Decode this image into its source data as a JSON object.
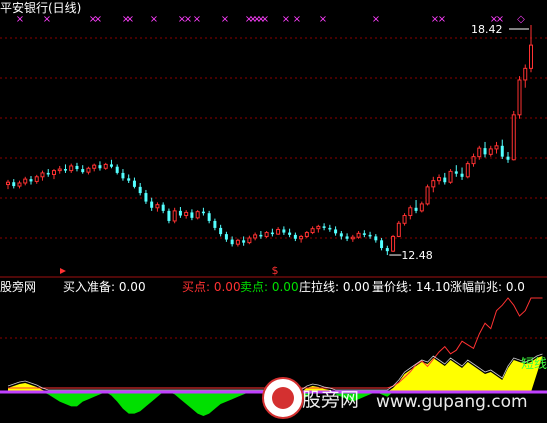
{
  "window": {
    "title": "平安银行(日线)"
  },
  "colors": {
    "background": "#000000",
    "up": "#ff3232",
    "down": "#54ffff",
    "grid": "#8b0000",
    "marker": "#ff40ff",
    "line_white": "#ffffff",
    "yellow": "#ffff00",
    "green": "#00e000",
    "magenta": "#ff40ff"
  },
  "chart_data": [
    {
      "type": "candlestick",
      "title": "平安银行(日线)",
      "annotations": {
        "high_label": "18.42",
        "low_label": "12.48"
      },
      "top_markers": [
        "×",
        "×",
        "×",
        "×",
        "×",
        "×",
        "×",
        "×",
        "×",
        "×",
        "×",
        "×",
        "×",
        "×",
        "×",
        "×",
        "×",
        "×",
        "×",
        "×",
        "×",
        "×",
        "×",
        "×",
        "◇"
      ],
      "signal_marker": "$",
      "ohlc": [
        [
          14.3,
          14.42,
          14.18,
          14.36
        ],
        [
          14.36,
          14.44,
          14.2,
          14.26
        ],
        [
          14.26,
          14.4,
          14.2,
          14.34
        ],
        [
          14.34,
          14.5,
          14.28,
          14.44
        ],
        [
          14.44,
          14.52,
          14.3,
          14.38
        ],
        [
          14.38,
          14.55,
          14.32,
          14.5
        ],
        [
          14.5,
          14.66,
          14.4,
          14.6
        ],
        [
          14.6,
          14.7,
          14.5,
          14.56
        ],
        [
          14.56,
          14.7,
          14.44,
          14.66
        ],
        [
          14.66,
          14.78,
          14.58,
          14.7
        ],
        [
          14.7,
          14.82,
          14.6,
          14.66
        ],
        [
          14.66,
          14.84,
          14.6,
          14.78
        ],
        [
          14.78,
          14.86,
          14.64,
          14.7
        ],
        [
          14.7,
          14.8,
          14.58,
          14.62
        ],
        [
          14.62,
          14.76,
          14.56,
          14.72
        ],
        [
          14.72,
          14.84,
          14.64,
          14.8
        ],
        [
          14.8,
          14.9,
          14.66,
          14.72
        ],
        [
          14.72,
          14.86,
          14.68,
          14.82
        ],
        [
          14.82,
          14.94,
          14.72,
          14.76
        ],
        [
          14.76,
          14.82,
          14.56,
          14.6
        ],
        [
          14.6,
          14.7,
          14.4,
          14.46
        ],
        [
          14.46,
          14.56,
          14.34,
          14.4
        ],
        [
          14.4,
          14.48,
          14.2,
          14.24
        ],
        [
          14.24,
          14.34,
          14.02,
          14.08
        ],
        [
          14.08,
          14.16,
          13.8,
          13.86
        ],
        [
          13.86,
          13.96,
          13.62,
          13.7
        ],
        [
          13.7,
          13.84,
          13.6,
          13.78
        ],
        [
          13.78,
          13.84,
          13.56,
          13.62
        ],
        [
          13.62,
          13.68,
          13.3,
          13.36
        ],
        [
          13.36,
          13.7,
          13.3,
          13.62
        ],
        [
          13.62,
          13.72,
          13.44,
          13.5
        ],
        [
          13.5,
          13.64,
          13.42,
          13.58
        ],
        [
          13.58,
          13.66,
          13.38,
          13.44
        ],
        [
          13.44,
          13.64,
          13.4,
          13.6
        ],
        [
          13.6,
          13.7,
          13.5,
          13.56
        ],
        [
          13.56,
          13.62,
          13.3,
          13.36
        ],
        [
          13.36,
          13.42,
          13.12,
          13.18
        ],
        [
          13.18,
          13.26,
          12.96,
          13.02
        ],
        [
          13.02,
          13.08,
          12.82,
          12.88
        ],
        [
          12.88,
          12.96,
          12.7,
          12.76
        ],
        [
          12.76,
          12.9,
          12.7,
          12.86
        ],
        [
          12.86,
          12.96,
          12.72,
          12.8
        ],
        [
          12.8,
          12.98,
          12.76,
          12.92
        ],
        [
          12.92,
          13.06,
          12.86,
          13.0
        ],
        [
          13.0,
          13.1,
          12.9,
          12.96
        ],
        [
          12.96,
          13.1,
          12.92,
          13.06
        ],
        [
          13.06,
          13.16,
          12.96,
          13.02
        ],
        [
          13.02,
          13.2,
          13.0,
          13.14
        ],
        [
          13.14,
          13.22,
          13.0,
          13.06
        ],
        [
          13.06,
          13.16,
          12.94,
          13.0
        ],
        [
          13.0,
          13.06,
          12.84,
          12.9
        ],
        [
          12.9,
          13.0,
          12.8,
          12.96
        ],
        [
          12.96,
          13.1,
          12.92,
          13.06
        ],
        [
          13.06,
          13.22,
          13.02,
          13.16
        ],
        [
          13.16,
          13.26,
          13.06,
          13.22
        ],
        [
          13.22,
          13.3,
          13.12,
          13.18
        ],
        [
          13.18,
          13.26,
          13.08,
          13.14
        ],
        [
          13.14,
          13.22,
          12.98,
          13.04
        ],
        [
          13.04,
          13.1,
          12.88,
          12.96
        ],
        [
          12.96,
          13.04,
          12.84,
          12.9
        ],
        [
          12.9,
          13.0,
          12.82,
          12.94
        ],
        [
          12.94,
          13.1,
          12.9,
          13.04
        ],
        [
          13.04,
          13.12,
          12.94,
          13.0
        ],
        [
          13.0,
          13.08,
          12.9,
          12.96
        ],
        [
          12.96,
          13.02,
          12.8,
          12.86
        ],
        [
          12.86,
          12.92,
          12.6,
          12.66
        ],
        [
          12.66,
          12.72,
          12.48,
          12.58
        ],
        [
          12.58,
          13.0,
          12.56,
          12.96
        ],
        [
          12.96,
          13.36,
          12.94,
          13.3
        ],
        [
          13.3,
          13.56,
          13.24,
          13.5
        ],
        [
          13.5,
          13.76,
          13.4,
          13.7
        ],
        [
          13.7,
          13.9,
          13.56,
          13.62
        ],
        [
          13.62,
          13.86,
          13.58,
          13.8
        ],
        [
          13.8,
          14.3,
          13.76,
          14.24
        ],
        [
          14.24,
          14.5,
          14.1,
          14.4
        ],
        [
          14.4,
          14.56,
          14.3,
          14.48
        ],
        [
          14.48,
          14.6,
          14.3,
          14.36
        ],
        [
          14.36,
          14.7,
          14.32,
          14.64
        ],
        [
          14.64,
          14.8,
          14.5,
          14.58
        ],
        [
          14.58,
          14.74,
          14.42,
          14.5
        ],
        [
          14.5,
          14.9,
          14.46,
          14.84
        ],
        [
          14.84,
          15.1,
          14.76,
          15.02
        ],
        [
          15.02,
          15.3,
          14.94,
          15.24
        ],
        [
          15.24,
          15.4,
          15.0,
          15.08
        ],
        [
          15.08,
          15.3,
          15.02,
          15.22
        ],
        [
          15.22,
          15.4,
          15.1,
          15.3
        ],
        [
          15.3,
          15.46,
          14.96,
          15.02
        ],
        [
          15.02,
          15.14,
          14.86,
          14.94
        ],
        [
          14.94,
          16.2,
          14.92,
          16.1
        ],
        [
          16.1,
          17.1,
          16.0,
          17.0
        ],
        [
          17.0,
          17.4,
          16.8,
          17.3
        ],
        [
          17.3,
          18.42,
          17.2,
          17.9
        ]
      ],
      "indicator": {
        "label_prefix": "股旁网",
        "labels": [
          {
            "name": "买入准备",
            "value": "0.00",
            "color": "#ffffff"
          },
          {
            "name": "买点",
            "value": "0.00",
            "color": "#ff3232"
          },
          {
            "name": "卖点",
            "value": "0.00",
            "color": "#00e000"
          },
          {
            "name": "庄拉线",
            "value": "0.00",
            "color": "#ffffff"
          },
          {
            "name": "量价线",
            "value": "14.10",
            "color": "#ffffff"
          },
          {
            "name": "涨幅前兆",
            "value": "0.0",
            "color": "#ffffff"
          }
        ],
        "red_line": [
          0,
          0,
          0,
          0,
          0,
          0,
          0,
          0,
          0,
          0,
          0,
          0,
          0,
          0,
          0,
          0,
          0,
          0,
          0,
          0,
          0,
          0,
          0,
          0,
          0,
          0,
          0,
          0,
          0,
          0,
          0,
          0,
          0,
          0,
          0,
          0,
          0,
          0,
          0,
          0,
          0,
          0,
          0,
          0,
          0,
          0,
          0,
          0,
          0,
          0,
          0,
          0,
          0,
          0,
          0,
          0,
          0,
          0,
          0,
          0,
          0,
          0,
          0,
          0,
          0,
          0,
          0,
          2,
          6,
          12,
          18,
          26,
          30,
          24,
          32,
          40,
          46,
          38,
          42,
          52,
          48,
          44,
          60,
          72,
          66,
          86,
          92,
          100,
          92,
          80,
          86,
          100,
          100,
          100
        ],
        "yellow_area": [
          4,
          6,
          8,
          9,
          7,
          5,
          2,
          0,
          0,
          0,
          0,
          0,
          0,
          0,
          0,
          0,
          0,
          0,
          0,
          0,
          0,
          0,
          0,
          0,
          0,
          0,
          0,
          0,
          0,
          0,
          0,
          0,
          0,
          0,
          0,
          0,
          0,
          0,
          0,
          0,
          0,
          0,
          0,
          0,
          0,
          0,
          2,
          3,
          2,
          0,
          0,
          0,
          4,
          6,
          5,
          3,
          2,
          0,
          0,
          0,
          0,
          0,
          0,
          0,
          0,
          0,
          0,
          4,
          10,
          18,
          22,
          26,
          30,
          28,
          34,
          30,
          26,
          32,
          28,
          24,
          30,
          26,
          22,
          18,
          20,
          16,
          12,
          24,
          32,
          30,
          28,
          30,
          34,
          36
        ],
        "green_area": [
          0,
          0,
          0,
          0,
          0,
          0,
          0,
          -2,
          -5,
          -8,
          -10,
          -12,
          -12,
          -8,
          -6,
          -4,
          -2,
          0,
          -3,
          -8,
          -14,
          -18,
          -18,
          -16,
          -12,
          -8,
          -4,
          0,
          0,
          -2,
          -6,
          -10,
          -14,
          -18,
          -20,
          -18,
          -14,
          -10,
          -8,
          -6,
          -4,
          -2,
          0,
          0,
          0,
          0,
          0,
          0,
          0,
          -2,
          -4,
          -6,
          -4,
          0,
          0,
          0,
          0,
          -2,
          -4,
          -6,
          -8,
          -6,
          -4,
          -2,
          0,
          -2,
          -4,
          0,
          0,
          0,
          0,
          0,
          0,
          0,
          0,
          0,
          0,
          0,
          0,
          0,
          0,
          0,
          0,
          0,
          0,
          0,
          0,
          0,
          0,
          0,
          0,
          0,
          0
        ],
        "watermark_cn": "股旁网",
        "watermark_en": "www.gupang.com",
        "corner_tag": "短线"
      }
    }
  ]
}
